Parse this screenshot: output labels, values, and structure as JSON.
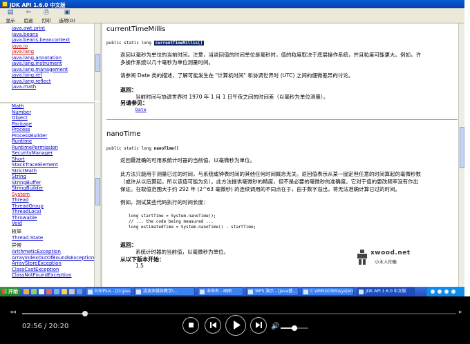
{
  "window": {
    "title": "JDK API 1.6.0 中文版"
  },
  "toolbar": {
    "buttons": [
      {
        "label": "显示",
        "icon": "show-icon"
      },
      {
        "label": "后退",
        "icon": "back-arrow-icon"
      },
      {
        "label": "打印",
        "icon": "print-icon"
      },
      {
        "label": "选项(O)",
        "icon": "options-icon"
      }
    ]
  },
  "packages": [
    "java.awt.print",
    "java.beans",
    "java.beans.beancontext",
    "java.io",
    "java.lang",
    "java.lang.annotation",
    "java.lang.instrument",
    "java.lang.management",
    "java.lang.ref",
    "java.lang.reflect",
    "java.math"
  ],
  "classes": [
    "Math",
    "Number",
    "Object",
    "Package",
    "Process",
    "ProcessBuilder",
    "Runtime",
    "RuntimePermission",
    "SecurityManager",
    "Short",
    "StackTraceElement",
    "StrictMath",
    "String",
    "StringBuffer",
    "StringBuilder",
    "System",
    "Thread",
    "ThreadGroup",
    "ThreadLocal",
    "Throwable",
    "Void"
  ],
  "enum_heading": "枚举",
  "enums": [
    "Thread.State"
  ],
  "exception_heading": "异常",
  "exceptions": [
    "ArithmeticException",
    "ArrayIndexOutOfBoundsException",
    "ArrayStoreException",
    "ClassCastException",
    "ClassNotFoundException"
  ],
  "method1": {
    "name": "currentTimeMillis",
    "sig_prefix": "public static long ",
    "sig_name": "currentTimeMillis()",
    "desc": "返回以毫秒为单位的当前时间。注意，当返回值的时间单位是毫秒时，值的粒度取决于底层操作系统，并且粒度可能更大。例如，许",
    "desc2": "多操作系统以几十毫秒为单位测量时间。",
    "see_desc": "请参阅 Date 类的描述，了解可能发生在 \"计算机时间\" 和协调世界时 (UTC) 之间的细微差异的讨论。",
    "returns_label": "返回：",
    "returns": "当前时间与协调世界时 1970 年 1 月 1 日午夜之间的时间差（以毫秒为单位测量）。",
    "see_label": "另请参见：",
    "see_link": "Date"
  },
  "method2": {
    "name": "nanoTime",
    "sig_prefix": "public static long ",
    "sig_name": "nanoTime()",
    "desc": "返回最准确的可用系统计时器的当前值，以毫微秒为单位。",
    "p1": "此方法只能用于测量已过的时间，与系统或钟表时间的其他任何时间概念无关。返回值表示从某一固定但任意的时间算起的毫微秒数",
    "p2": "（或许从以后算起，所以该值可能为负）。此方法提供毫微秒的精度，但不是必要的毫微秒的准确度。它对于值的更改频率没有作出",
    "p3": "保证。在取值范围大于约 292 年 (2^63 毫微秒) 的连续调用的不同点在于，由于数字溢出，将无法准确计算已过的时间。",
    "example": "例如，测试某些代码执行的时间长度：",
    "code": "long startTime = System.nanoTime();\n// ... the code being measured ...\nlong estimatedTime = System.nanoTime() - startTime;",
    "returns_label": "返回：",
    "returns": "系统计时器的当前值，以毫微秒为单位。",
    "since_label": "从以下版本开始：",
    "since": "1.5"
  },
  "watermark": {
    "brand": "xwood.net",
    "sub": "小木人印象"
  },
  "taskbar": {
    "start": "开始",
    "tasks": [
      "EditPlus - [D:\\java021...",
      "凌波多媒体教学(... ",
      "未命名 - 画图",
      "WPS 演示 - [Java基...",
      "C:\\WINDOWS\\system...",
      "JDK API 1.6.0 中文版"
    ]
  },
  "player": {
    "time": "02:56 / 20:20",
    "progress": 0.1443,
    "volume": 0.5
  }
}
